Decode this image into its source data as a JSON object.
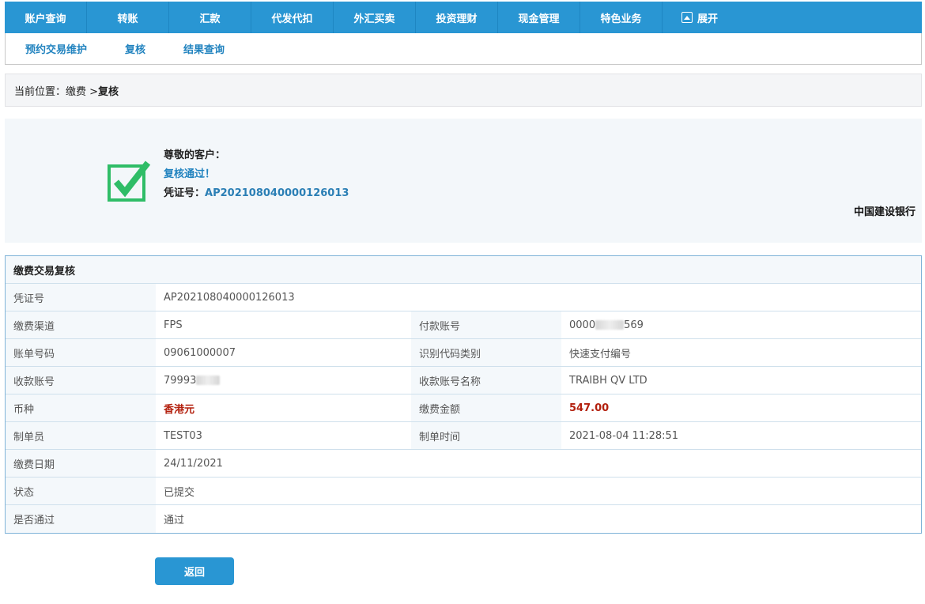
{
  "topnav": {
    "items": [
      "账户查询",
      "转账",
      "汇款",
      "代发代扣",
      "外汇买卖",
      "投资理财",
      "现金管理",
      "特色业务"
    ],
    "expand_label": "展开"
  },
  "subnav": {
    "items": [
      "预约交易维护",
      "复核",
      "结果查询"
    ]
  },
  "breadcrumb": {
    "prefix": "当前位置：缴费 > ",
    "current": "复核"
  },
  "success": {
    "greeting": "尊敬的客户：",
    "message": "复核通过！",
    "voucher_label": "凭证号：",
    "voucher_no": "AP202108040000126013",
    "bank_name": "中国建设银行"
  },
  "detail": {
    "title": "缴费交易复核",
    "rows": {
      "voucher": {
        "label": "凭证号",
        "value": "AP202108040000126013"
      },
      "channel": {
        "label": "缴费渠道",
        "value": "FPS",
        "label2": "付款账号",
        "value2_prefix": "0000",
        "value2_suffix": "569"
      },
      "bill": {
        "label": "账单号码",
        "value": "09061000007",
        "label2": "识别代码类别",
        "value2": "快速支付编号"
      },
      "payee": {
        "label": "收款账号",
        "value_prefix": "79993",
        "label2": "收款账号名称",
        "value2": "TRAIBH QV LTD"
      },
      "currency": {
        "label": "币种",
        "value": "香港元",
        "label2": "缴费金额",
        "value2": "547.00"
      },
      "maker": {
        "label": "制单员",
        "value": "TEST03",
        "label2": "制单时间",
        "value2": "2021-08-04 11:28:51"
      },
      "date": {
        "label": "缴费日期",
        "value": "24/11/2021"
      },
      "status": {
        "label": "状态",
        "value": "已提交"
      },
      "approved": {
        "label": "是否通过",
        "value": "通过"
      }
    }
  },
  "buttons": {
    "return_label": "返回"
  },
  "colors": {
    "primary": "#2996d3",
    "success_green": "#2fbd67",
    "amount_red": "#b3200e"
  }
}
